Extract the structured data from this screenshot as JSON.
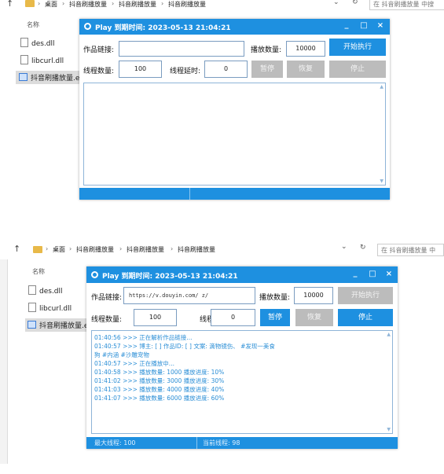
{
  "explorer": {
    "breadcrumb_1": "桌面",
    "breadcrumb_2": "抖音刷播放量",
    "breadcrumb_3": "抖音刷播放量",
    "breadcrumb_4": "抖音刷播放量",
    "search_top": "在 抖音刷播放量 中搜",
    "search_bottom": "在 抖音刷播放量 中",
    "column_name": "名称",
    "files": [
      "des.dll",
      "libcurl.dll",
      "抖音刷播放量.exe"
    ]
  },
  "window_top": {
    "title": "Play  到期时间: 2023-05-13 21:04:21",
    "work_link_label": "作品链接:",
    "work_link_value": "",
    "play_count_label": "播放数量:",
    "play_count_value": "10000",
    "start_label": "开始执行",
    "threads_label": "线程数量:",
    "threads_value": "100",
    "timeout_label": "线程延时:",
    "timeout_value": "0",
    "pause_label": "暂停",
    "resume_label": "恢复",
    "stop_label": "停止"
  },
  "window_bottom": {
    "title": "Play  到期时间: 2023-05-13 21:04:21",
    "work_link_label": "作品链接:",
    "work_link_value": "https://v.douyin.com/          z/",
    "play_count_label": "播放数量:",
    "play_count_value": "10000",
    "start_label": "开始执行",
    "threads_label": "线程数量:",
    "threads_value": "100",
    "timeout_label": "线程延时:",
    "timeout_value": "0",
    "pause_label": "暂停",
    "resume_label": "恢复",
    "stop_label": "停止",
    "log": [
      "01:40:56 >>> 正在解析作品链接...",
      "01:40:57 >>> 博主: [          ]   作品ID: [                    ]   文案: 滴物镜伤、 #发现一美食",
      "狗 #内涵 #沙雕宠物",
      "01:40:57 >>> 正在播放中...",
      "01:40:58 >>> 播放数量: 1000  播放进度: 10%",
      "01:41:02 >>> 播放数量: 3000  播放进度: 30%",
      "01:41:03 >>> 播放数量: 4000  播放进度: 40%",
      "01:41:07 >>> 播放数量: 6000  播放进度: 60%"
    ],
    "status_max_threads": "最大线程: 100",
    "status_current_threads": "当前线程: 98"
  },
  "colors": {
    "accent": "#1e90e0",
    "log_text": "#2a8ed6",
    "disabled_button": "#bcbcbc"
  }
}
